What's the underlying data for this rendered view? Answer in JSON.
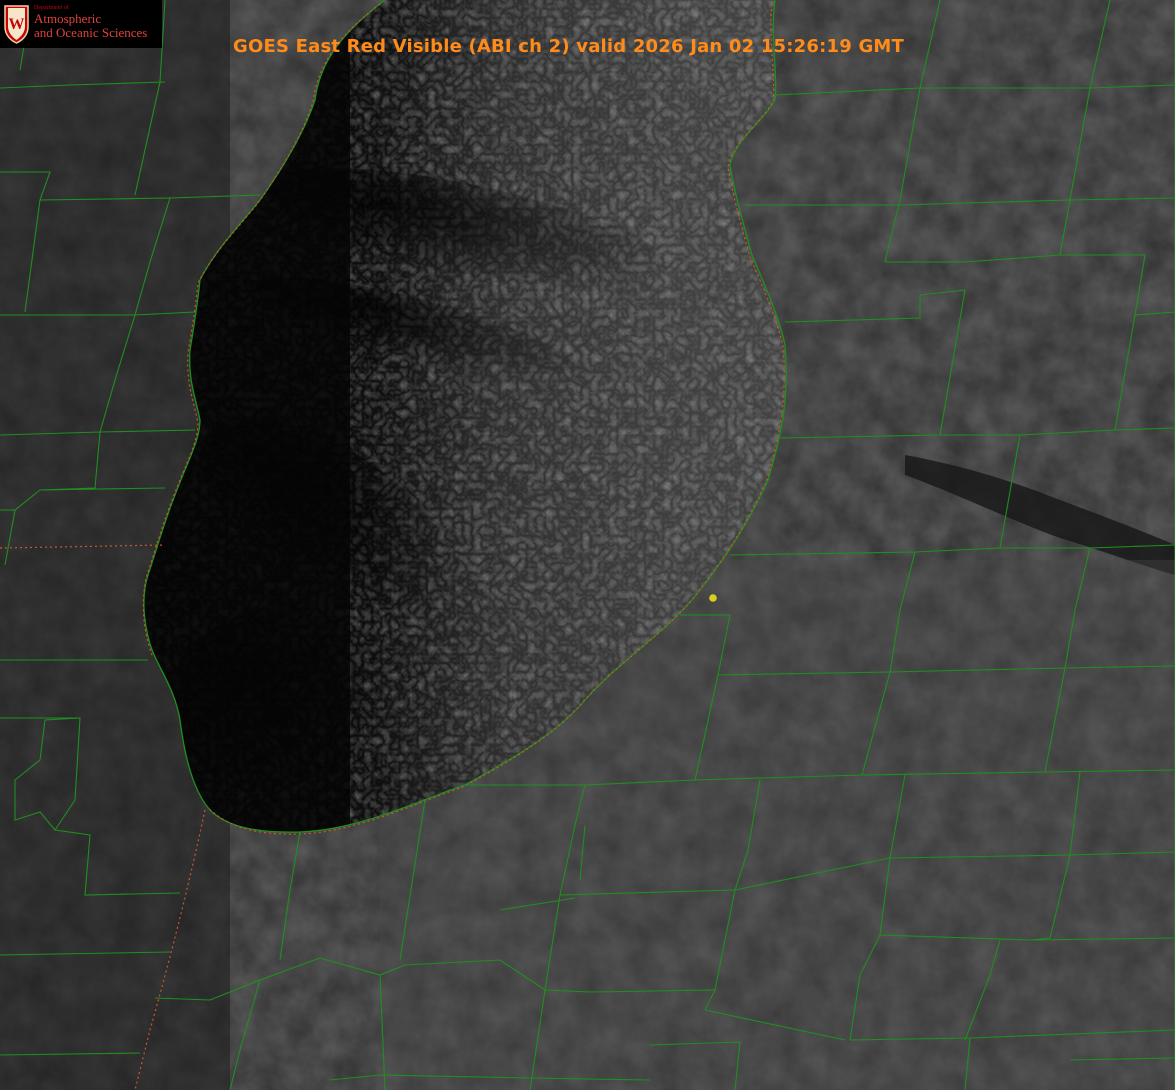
{
  "title": "GOES East Red Visible (ABI ch 2) valid 2026 Jan 02 15:26:19 GMT",
  "logo": {
    "dept": "Department of",
    "line1": "Atmospheric",
    "line2": "and Oceanic Sciences",
    "crest_letter": "W"
  },
  "colors": {
    "title": "#ff8c1a",
    "county_lines": "#1f8f1f",
    "state_border": "#c85a2a",
    "marker": "#d8d020"
  }
}
